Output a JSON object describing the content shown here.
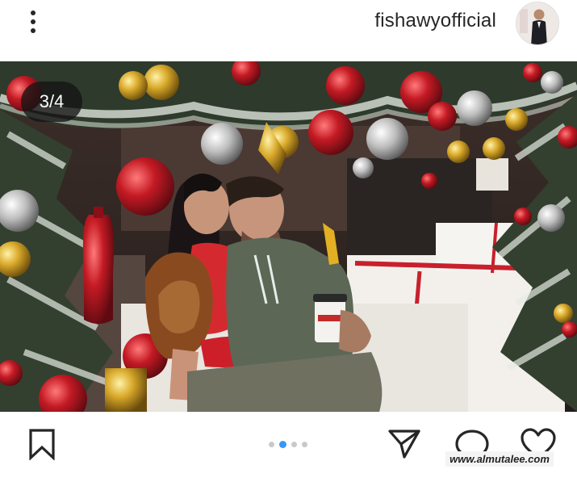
{
  "header": {
    "more_icon": "more-vertical-icon",
    "username": "fishawyofficial"
  },
  "carousel": {
    "counter": "3/4",
    "current_index": 2,
    "total": 4
  },
  "actions": {
    "bookmark_icon": "bookmark-icon",
    "share_icon": "send-icon",
    "comment_icon": "comment-icon",
    "like_icon": "heart-icon"
  },
  "watermark": "www.almutalee.com",
  "colors": {
    "text": "#262626",
    "active_dot": "#3897f0",
    "inactive_dot": "#c9c9c9"
  }
}
